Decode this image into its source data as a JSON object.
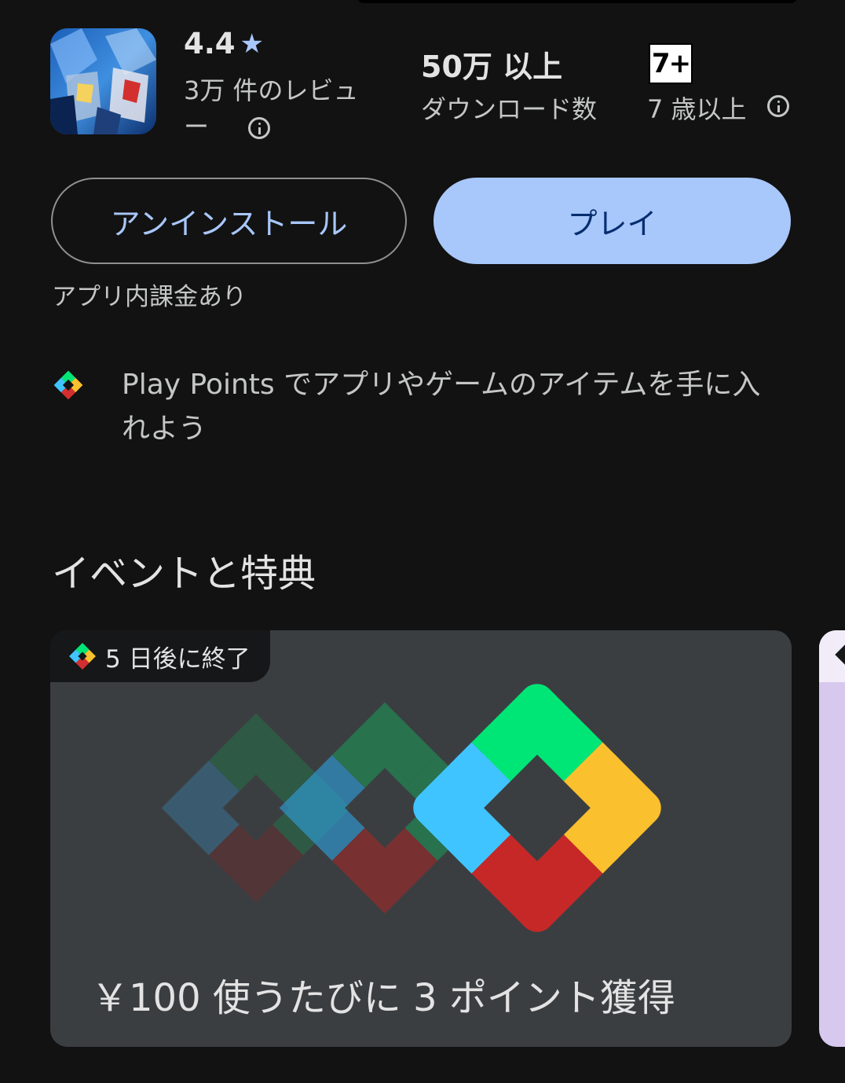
{
  "app": {
    "rating": "4.4",
    "reviews": "3万 件のレビュー",
    "downloads_value": "50万 以上",
    "downloads_label": "ダウンロード数",
    "age_badge": "7+",
    "age_label": "7 歳以上",
    "icon": "app-icon-robot-art"
  },
  "actions": {
    "uninstall_label": "アンインストール",
    "play_label": "プレイ",
    "in_app_purchases": "アプリ内課金あり"
  },
  "play_points": {
    "promo_text": "Play Points でアプリやゲームのアイテムを手に入れよう",
    "icon": "play-points-diamond-icon"
  },
  "events": {
    "section_title": "イベントと特典",
    "cards": [
      {
        "badge": "5 日後に終了",
        "text": "￥100 使うたびに 3 ポイント獲得"
      }
    ]
  },
  "colors": {
    "accent": "#a8c7fa",
    "background": "#121212",
    "card": "#3b3e41",
    "pp_green": "#00e676",
    "pp_blue": "#40c4ff",
    "pp_yellow": "#fbc02d",
    "pp_red": "#d32f2f"
  }
}
